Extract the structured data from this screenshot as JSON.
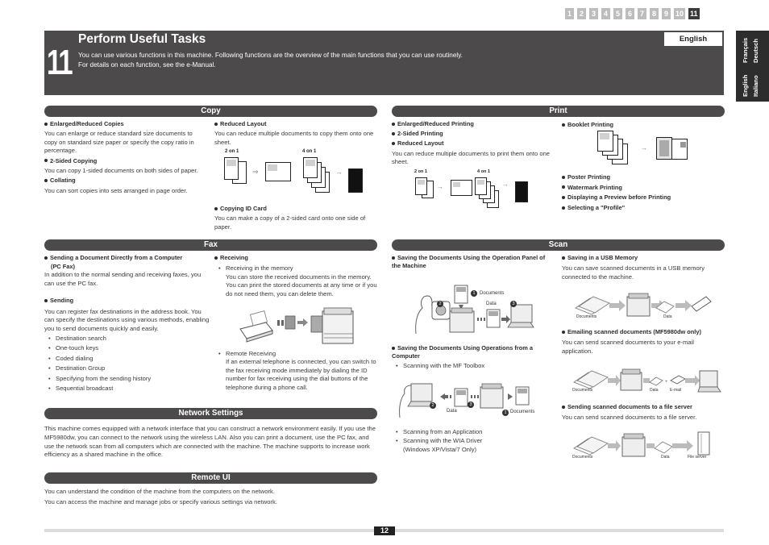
{
  "chapter_tabs": [
    "1",
    "2",
    "3",
    "4",
    "5",
    "6",
    "7",
    "8",
    "9",
    "10",
    "11"
  ],
  "active_chapter": "11",
  "header": {
    "number": "11",
    "title": "Perform Useful Tasks",
    "desc_line1": "You can use various functions in this machine. Following functions are the overview of the main functions that you can use routinely.",
    "desc_line2": "For details on each function, see the e-Manual.",
    "language": "English"
  },
  "language_tab": [
    "English",
    "Français",
    "Italiano",
    "Deutsch"
  ],
  "copy": {
    "title": "Copy",
    "enlarged_h": "Enlarged/Reduced Copies",
    "enlarged_t": "You can enlarge or reduce standard size documents to copy on standard size paper or specify the copy ratio in percentage.",
    "twosided_h": "2-Sided Copying",
    "twosided_t": "You can copy 1-sided documents on both sides of paper.",
    "collating_h": "Collating",
    "collating_t": "You can sort copies into sets arranged in page order.",
    "reduced_h": "Reduced Layout",
    "reduced_t": "You can reduce multiple documents to copy them onto one sheet.",
    "two_on_one": "2 on 1",
    "four_on_one": "4 on 1",
    "idcard_h": "Copying ID Card",
    "idcard_t": "You can make a copy of a 2-sided card onto one side of paper."
  },
  "print": {
    "title": "Print",
    "items_left": [
      "Enlarged/Reduced Printing",
      "2-Sided Printing",
      "Reduced Layout"
    ],
    "reduced_t": "You can reduce multiple documents to print them onto one sheet.",
    "two_on_one": "2 on 1",
    "four_on_one": "4 on 1",
    "booklet_h": "Booklet Printing",
    "items_right": [
      "Poster Printing",
      "Watermark Printing",
      "Displaying a Preview before Printing",
      "Selecting a \"Profile\""
    ]
  },
  "fax": {
    "title": "Fax",
    "pcfax_h1": "Sending a Document Directly from a Computer",
    "pcfax_h2": "(PC Fax)",
    "pcfax_t": "In addition to the normal sending and receiving faxes, you can use the PC fax.",
    "sending_h": "Sending",
    "sending_t": "You can register fax destinations in the address book. You can specify the destinations using various methods, enabling you to send documents quickly and easily.",
    "sending_list": [
      "Destination search",
      "One-touch keys",
      "Coded dialing",
      "Destination Group",
      "Specifying from the sending history",
      "Sequential broadcast"
    ],
    "receiving_h": "Receiving",
    "memory_h": "Receiving in the memory",
    "memory_t": "You can store the received documents in the memory. You can print the stored documents at any time or if you do not need them, you can delete them.",
    "remote_h": "Remote Receiving",
    "remote_t": "If an external telephone is connected, you can switch to the fax receiving mode immediately by dialing the ID number for fax receiving using the dial buttons of the telephone during a phone call."
  },
  "scan": {
    "title": "Scan",
    "panel_h": "Saving the Documents Using the Operation Panel of the Machine",
    "panel_labels": {
      "n1": "1",
      "documents": "Documents",
      "n2": "2",
      "data": "Data",
      "n3": "3"
    },
    "computer_h": "Saving the Documents Using Operations from a Computer",
    "toolbox": "Scanning with the MF Toolbox",
    "computer_labels": {
      "n2": "2",
      "data": "Data",
      "n3": "3",
      "n1": "1",
      "documents": "Documents"
    },
    "app": "Scanning from an Application",
    "wia1": "Scanning with the WIA Driver",
    "wia2": "(Windows XP/Vista/7 Only)",
    "usb_h": "Saving in a USB Memory",
    "usb_t": "You can save scanned documents in a USB memory connected to the machine.",
    "usb_labels": {
      "documents": "Documents",
      "data": "Data"
    },
    "email_h": "Emailing scanned documents (MF5980dw only)",
    "email_t": "You can send scanned documents to your e-mail application.",
    "email_labels": {
      "documents": "Documents",
      "data": "Data",
      "email": "E-mail"
    },
    "server_h": "Sending scanned documents to a file server",
    "server_t": "You can send scanned documents to a file server.",
    "server_labels": {
      "documents": "Documents",
      "data": "Data",
      "server": "File server"
    }
  },
  "network": {
    "title": "Network Settings",
    "text": "This machine comes equipped with a network interface that you can construct a network environment easily. If you use the MF5980dw, you can connect to the network using the wireless LAN. Also you can print a document, use the PC fax, and use the network scan from all computers which are connected with the machine. The machine supports to increase work efficiency as a shared machine in the office."
  },
  "remote_ui": {
    "title": "Remote UI",
    "line1": "You can understand the condition of the machine from the computers on the network.",
    "line2": "You can access the machine and manage jobs or specify various settings via network."
  },
  "page_number": "12",
  "colors": {
    "header_bg": "#4c4a4b",
    "tab_inactive": "#bdbdbd",
    "tab_active": "#3a3a3a",
    "footer_line": "#dcdcdc"
  }
}
